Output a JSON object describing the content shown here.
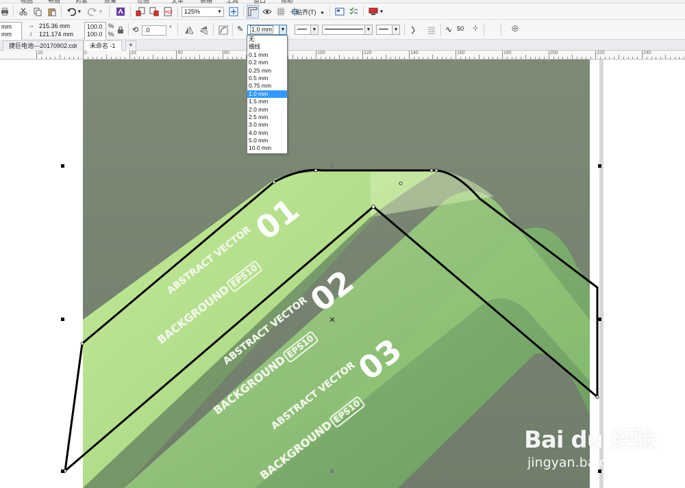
{
  "menu": {
    "items": [
      "视图",
      "布局",
      "对象",
      "效果",
      "位图",
      "文本",
      "表格",
      "工具",
      "窗口",
      "帮助"
    ]
  },
  "toolbar": {
    "zoom_value": "125%",
    "snap_label": "贴齐(T)"
  },
  "property_bar": {
    "x_value": "mm",
    "y_value": "mm",
    "width_value": "215.36 mm",
    "height_value": "121.174 mm",
    "scale_x": "100.0",
    "scale_y": "100.0",
    "percent_x": "%",
    "percent_y": "%",
    "rotation_value": ".0",
    "degree_symbol": "°",
    "outline_width_value": "1.0 mm",
    "smoothing_value": "50"
  },
  "outline_dropdown": {
    "options": [
      "无",
      "细线",
      "0.1 mm",
      "0.2 mm",
      "0.25 mm",
      "0.5 mm",
      "0.75 mm",
      "1.0 mm",
      "1.5 mm",
      "2.0 mm",
      "2.5 mm",
      "3.0 mm",
      "4.0 mm",
      "5.0 mm",
      "10.0 mm"
    ],
    "selected": "1.0 mm"
  },
  "tabs": [
    {
      "label": "捷巨电池---20170902.cdr",
      "active": false
    },
    {
      "label": "未命名 -1",
      "active": true
    }
  ],
  "ruler": {
    "labels": [
      "20",
      "0",
      "20",
      "40",
      "60",
      "80",
      "100",
      "120",
      "140",
      "160",
      "180",
      "200",
      "220",
      "240"
    ]
  },
  "artwork": {
    "banners": [
      {
        "line1": "ABSTRACT VECTOR",
        "line2": "BACKGROUND",
        "badge": "EPS10",
        "number": "01"
      },
      {
        "line1": "ABSTRACT VECTOR",
        "line2": "BACKGROUND",
        "badge": "EPS10",
        "number": "02"
      },
      {
        "line1": "ABSTRACT VECTOR",
        "line2": "BACKGROUND",
        "badge": "EPS10",
        "number": "03"
      }
    ]
  },
  "colors": {
    "canvas_bg": "#7a8a73",
    "ribbon_light": "#b8e08e",
    "selection_stroke": "#000000",
    "dropdown_highlight": "#3399ff"
  },
  "watermark": {
    "main": "Bai du 经验",
    "sub": "jingyan.baidu.com"
  }
}
